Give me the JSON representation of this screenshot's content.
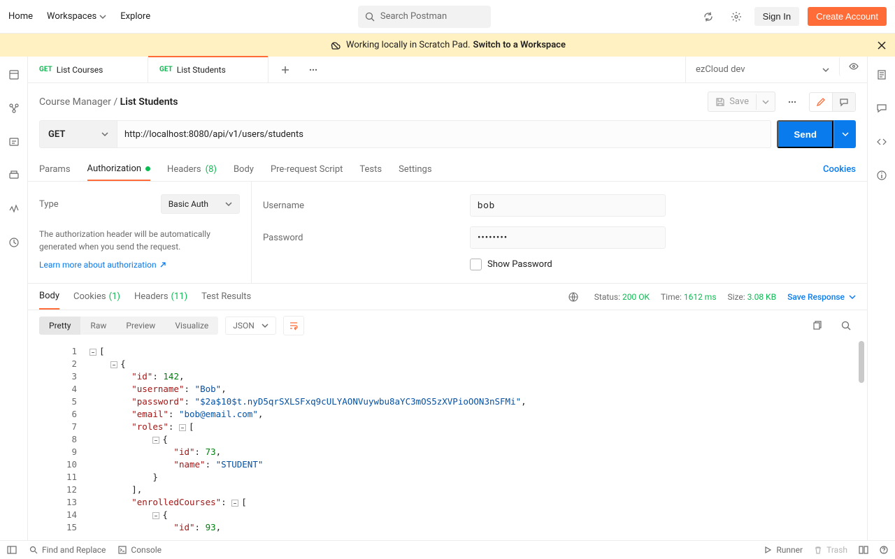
{
  "topnav": {
    "home": "Home",
    "workspaces": "Workspaces",
    "explore": "Explore"
  },
  "search": {
    "placeholder": "Search Postman"
  },
  "account": {
    "signin": "Sign In",
    "create": "Create Account"
  },
  "banner": {
    "text": "Working locally in Scratch Pad.",
    "link": "Switch to a Workspace"
  },
  "tabs": [
    {
      "method": "GET",
      "title": "List Courses",
      "active": false
    },
    {
      "method": "GET",
      "title": "List Students",
      "active": true
    }
  ],
  "environment": {
    "name": "ezCloud dev"
  },
  "breadcrumb": {
    "parent": "Course Manager",
    "current": "List Students"
  },
  "toolbar": {
    "save": "Save"
  },
  "request": {
    "method": "GET",
    "url": "http://localhost:8080/api/v1/users/students",
    "send": "Send"
  },
  "reqTabs": {
    "params": "Params",
    "authorization": "Authorization",
    "headers": "Headers",
    "headersCount": "(8)",
    "body": "Body",
    "prereq": "Pre-request Script",
    "tests": "Tests",
    "settings": "Settings",
    "cookies": "Cookies"
  },
  "auth": {
    "typeLabel": "Type",
    "typeValue": "Basic Auth",
    "desc": "The authorization header will be automatically generated when you send the request.",
    "learn": "Learn more about authorization",
    "usernameLabel": "Username",
    "usernameValue": "bob",
    "passwordLabel": "Password",
    "passwordValue": "••••••••",
    "showPassword": "Show Password"
  },
  "respTabs": {
    "body": "Body",
    "cookies": "Cookies",
    "cookiesCount": "(1)",
    "headers": "Headers",
    "headersCount": "(11)",
    "testResults": "Test Results"
  },
  "respMeta": {
    "statusLabel": "Status:",
    "statusValue": "200 OK",
    "timeLabel": "Time:",
    "timeValue": "1612 ms",
    "sizeLabel": "Size:",
    "sizeValue": "3.08 KB",
    "save": "Save Response"
  },
  "respView": {
    "pretty": "Pretty",
    "raw": "Raw",
    "preview": "Preview",
    "visualize": "Visualize",
    "format": "JSON"
  },
  "responseBody": [
    {
      "id": 142,
      "username": "Bob",
      "password": "$2a$10$t.nyD5qrSXLSFxq9cULYAONVuywbu8aYC3mOS5zXVPioOON3nSFMi",
      "email": "bob@email.com",
      "roles": [
        {
          "id": 73,
          "name": "STUDENT"
        }
      ],
      "enrolledCourses": [
        {
          "id": 93
        }
      ]
    }
  ],
  "codeLines": [
    "1",
    "2",
    "3",
    "4",
    "5",
    "6",
    "7",
    "8",
    "9",
    "10",
    "11",
    "12",
    "13",
    "14",
    "15"
  ],
  "statusbar": {
    "find": "Find and Replace",
    "console": "Console",
    "runner": "Runner",
    "trash": "Trash"
  }
}
